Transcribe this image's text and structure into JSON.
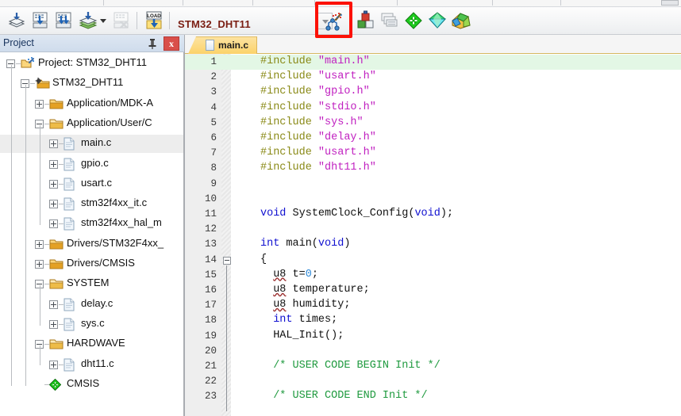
{
  "window": {
    "minimize_label": ""
  },
  "toolbar": {
    "project_name": "STM32_DHT11",
    "icons": [
      {
        "name": "batch-build-icon",
        "title": "Batch Build"
      },
      {
        "name": "build-target-icon",
        "title": "Translate"
      },
      {
        "name": "rebuild-icon",
        "title": "Build"
      },
      {
        "name": "rebuild-all-icon",
        "title": "Rebuild"
      },
      {
        "name": "build-dropdown-caret",
        "title": "Build options"
      },
      {
        "name": "stop-build-icon",
        "title": "Stop Build"
      },
      {
        "name": "download-load-icon",
        "title": "LOAD"
      },
      {
        "name": "target-options-caret",
        "title": "Select Target"
      },
      {
        "name": "configuration-wizard-icon",
        "title": "Configuration Wizard"
      },
      {
        "name": "target-options-icon",
        "title": "Options for Target"
      },
      {
        "name": "manage-components-icon",
        "title": "Manage Project Items"
      },
      {
        "name": "pack-installer-icon",
        "title": "Pack Installer"
      },
      {
        "name": "run-time-env-icon",
        "title": "Manage Run-Time Environment"
      },
      {
        "name": "multi-project-icon",
        "title": "Multi-Project"
      }
    ]
  },
  "project_panel": {
    "title": "Project",
    "pin_label": "",
    "close_label": "x",
    "tree": [
      {
        "label": "Project: STM32_DHT11",
        "depth": 0,
        "icon": "project-icon",
        "expander": "minus",
        "selected": false
      },
      {
        "label": "STM32_DHT11",
        "depth": 1,
        "icon": "target-folder-icon",
        "expander": "minus",
        "selected": false
      },
      {
        "label": "Application/MDK-A",
        "depth": 2,
        "icon": "folder-icon",
        "expander": "plus",
        "selected": false
      },
      {
        "label": "Application/User/C",
        "depth": 2,
        "icon": "folder-open-icon",
        "expander": "minus",
        "selected": false
      },
      {
        "label": "main.c",
        "depth": 3,
        "icon": "file-icon",
        "expander": "plus",
        "selected": true
      },
      {
        "label": "gpio.c",
        "depth": 3,
        "icon": "file-icon",
        "expander": "plus",
        "selected": false
      },
      {
        "label": "usart.c",
        "depth": 3,
        "icon": "file-icon",
        "expander": "plus",
        "selected": false
      },
      {
        "label": "stm32f4xx_it.c",
        "depth": 3,
        "icon": "file-icon",
        "expander": "plus",
        "selected": false
      },
      {
        "label": "stm32f4xx_hal_m",
        "depth": 3,
        "icon": "file-icon",
        "expander": "plus",
        "selected": false
      },
      {
        "label": "Drivers/STM32F4xx_",
        "depth": 2,
        "icon": "folder-icon",
        "expander": "plus",
        "selected": false
      },
      {
        "label": "Drivers/CMSIS",
        "depth": 2,
        "icon": "folder-icon",
        "expander": "plus",
        "selected": false
      },
      {
        "label": "SYSTEM",
        "depth": 2,
        "icon": "folder-open-icon",
        "expander": "minus",
        "selected": false
      },
      {
        "label": "delay.c",
        "depth": 3,
        "icon": "file-icon",
        "expander": "plus",
        "selected": false
      },
      {
        "label": "sys.c",
        "depth": 3,
        "icon": "file-icon",
        "expander": "plus",
        "selected": false
      },
      {
        "label": "HARDWAVE",
        "depth": 2,
        "icon": "folder-open-icon",
        "expander": "minus",
        "selected": false
      },
      {
        "label": "dht11.c",
        "depth": 3,
        "icon": "file-icon",
        "expander": "plus",
        "selected": false
      },
      {
        "label": "CMSIS",
        "depth": 2,
        "icon": "cmsis-diamond-icon",
        "expander": "none",
        "selected": false
      }
    ]
  },
  "editor": {
    "tabs": [
      {
        "label": "main.c",
        "active": true
      }
    ],
    "lines": [
      {
        "n": 1,
        "highlight": true,
        "tokens": [
          {
            "t": "#include ",
            "c": "pre"
          },
          {
            "t": "\"main.h\"",
            "c": "str"
          }
        ]
      },
      {
        "n": 2,
        "highlight": false,
        "tokens": [
          {
            "t": "#include ",
            "c": "pre"
          },
          {
            "t": "\"usart.h\"",
            "c": "str"
          }
        ]
      },
      {
        "n": 3,
        "highlight": false,
        "tokens": [
          {
            "t": "#include ",
            "c": "pre"
          },
          {
            "t": "\"gpio.h\"",
            "c": "str"
          }
        ]
      },
      {
        "n": 4,
        "highlight": false,
        "tokens": [
          {
            "t": "#include ",
            "c": "pre"
          },
          {
            "t": "\"stdio.h\"",
            "c": "str"
          }
        ]
      },
      {
        "n": 5,
        "highlight": false,
        "tokens": [
          {
            "t": "#include ",
            "c": "pre"
          },
          {
            "t": "\"sys.h\"",
            "c": "str"
          }
        ]
      },
      {
        "n": 6,
        "highlight": false,
        "tokens": [
          {
            "t": "#include ",
            "c": "pre"
          },
          {
            "t": "\"delay.h\"",
            "c": "str"
          }
        ]
      },
      {
        "n": 7,
        "highlight": false,
        "tokens": [
          {
            "t": "#include ",
            "c": "pre"
          },
          {
            "t": "\"usart.h\"",
            "c": "str"
          }
        ]
      },
      {
        "n": 8,
        "highlight": false,
        "tokens": [
          {
            "t": "#include ",
            "c": "pre"
          },
          {
            "t": "\"dht11.h\"",
            "c": "str"
          }
        ]
      },
      {
        "n": 9,
        "highlight": false,
        "tokens": []
      },
      {
        "n": 10,
        "highlight": false,
        "tokens": []
      },
      {
        "n": 11,
        "highlight": false,
        "tokens": [
          {
            "t": "void ",
            "c": "kw"
          },
          {
            "t": "SystemClock_Config(",
            "c": "id"
          },
          {
            "t": "void",
            "c": "kw"
          },
          {
            "t": ");",
            "c": "id"
          }
        ]
      },
      {
        "n": 12,
        "highlight": false,
        "tokens": []
      },
      {
        "n": 13,
        "highlight": false,
        "tokens": [
          {
            "t": "int ",
            "c": "kw"
          },
          {
            "t": "main(",
            "c": "id"
          },
          {
            "t": "void",
            "c": "kw"
          },
          {
            "t": ")",
            "c": "id"
          }
        ]
      },
      {
        "n": 14,
        "highlight": false,
        "fold": "start",
        "tokens": [
          {
            "t": "{",
            "c": "id"
          }
        ]
      },
      {
        "n": 15,
        "highlight": false,
        "tokens": [
          {
            "t": "  ",
            "c": "id"
          },
          {
            "t": "u8",
            "c": "sq"
          },
          {
            "t": " t=",
            "c": "id"
          },
          {
            "t": "0",
            "c": "num"
          },
          {
            "t": ";",
            "c": "id"
          }
        ]
      },
      {
        "n": 16,
        "highlight": false,
        "tokens": [
          {
            "t": "  ",
            "c": "id"
          },
          {
            "t": "u8",
            "c": "sq"
          },
          {
            "t": " temperature;",
            "c": "id"
          }
        ]
      },
      {
        "n": 17,
        "highlight": false,
        "tokens": [
          {
            "t": "  ",
            "c": "id"
          },
          {
            "t": "u8",
            "c": "sq"
          },
          {
            "t": " humidity;",
            "c": "id"
          }
        ]
      },
      {
        "n": 18,
        "highlight": false,
        "tokens": [
          {
            "t": "  ",
            "c": "id"
          },
          {
            "t": "int",
            "c": "kw"
          },
          {
            "t": " times;",
            "c": "id"
          }
        ]
      },
      {
        "n": 19,
        "highlight": false,
        "tokens": [
          {
            "t": "  HAL_Init();",
            "c": "id"
          }
        ]
      },
      {
        "n": 20,
        "highlight": false,
        "tokens": []
      },
      {
        "n": 21,
        "highlight": false,
        "tokens": [
          {
            "t": "  ",
            "c": "id"
          },
          {
            "t": "/* USER CODE BEGIN Init */",
            "c": "com"
          }
        ]
      },
      {
        "n": 22,
        "highlight": false,
        "tokens": []
      },
      {
        "n": 23,
        "highlight": false,
        "tokens": [
          {
            "t": "  ",
            "c": "id"
          },
          {
            "t": "/* USER CODE END Init */",
            "c": "com"
          }
        ]
      }
    ]
  },
  "annotation": {
    "highlight_color": "#fc1106",
    "target": "configuration-wizard-icon"
  }
}
